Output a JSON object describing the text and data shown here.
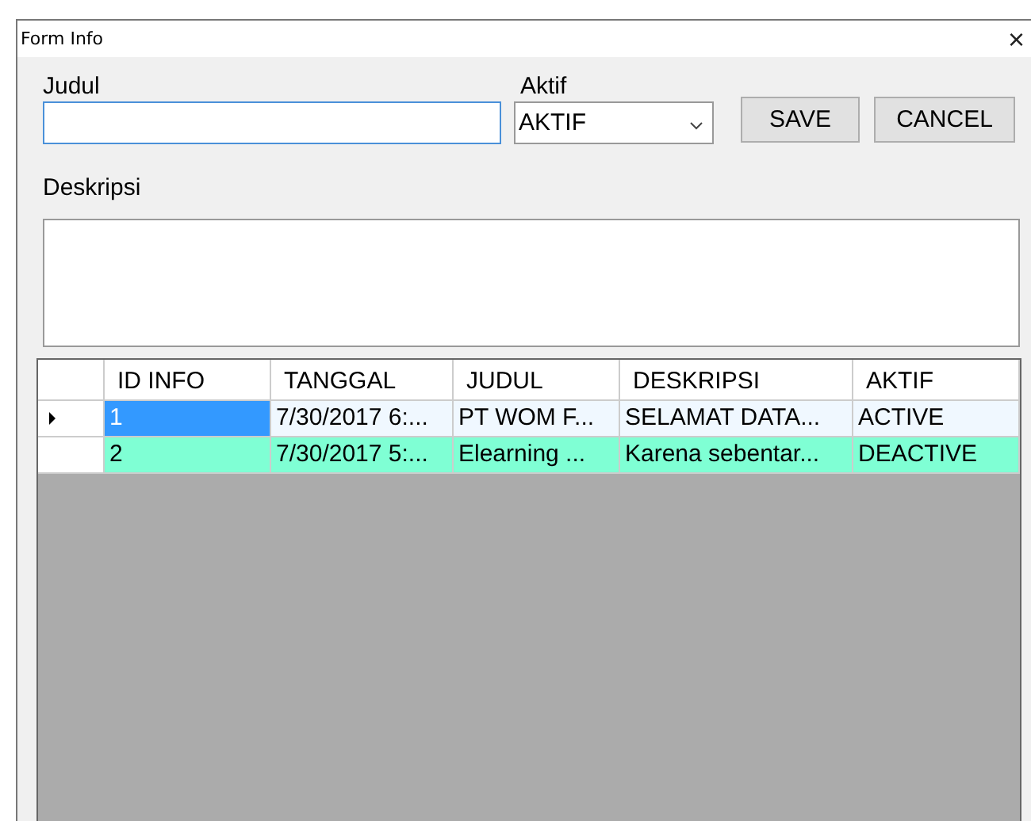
{
  "window": {
    "title": "Form Info",
    "close": "×"
  },
  "form": {
    "judul_label": "Judul",
    "aktif_label": "Aktif",
    "aktif_value": "AKTIF",
    "deskripsi_label": "Deskripsi"
  },
  "buttons": [
    "SAVE",
    "CANCEL"
  ],
  "table": {
    "columns": [
      "ID INFO",
      "TANGGAL",
      "JUDUL",
      "DESKRIPSI",
      "AKTIF"
    ],
    "rows": [
      {
        "cells": [
          "1",
          "7/30/2017 6:...",
          "PT WOM F...",
          "SELAMAT DATA...",
          "ACTIVE"
        ],
        "selected": true,
        "color": "#f0f8ff"
      },
      {
        "cells": [
          "2",
          "7/30/2017 5:...",
          "Elearning ...",
          "Karena sebentar...",
          "DEACTIVE"
        ],
        "selected": false,
        "color": "#7fffd4"
      }
    ]
  }
}
